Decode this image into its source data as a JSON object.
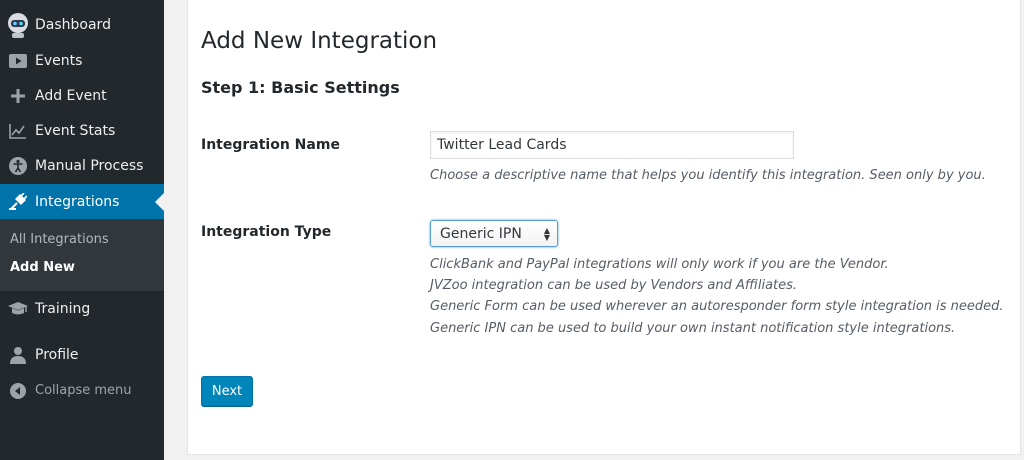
{
  "sidebar": {
    "items": [
      {
        "label": "Dashboard",
        "icon": "robot-avatar-icon"
      },
      {
        "label": "Events",
        "icon": "play-icon"
      },
      {
        "label": "Add Event",
        "icon": "plus-icon"
      },
      {
        "label": "Event Stats",
        "icon": "chart-icon"
      },
      {
        "label": "Manual Process",
        "icon": "accessibility-icon"
      },
      {
        "label": "Integrations",
        "icon": "plug-icon"
      },
      {
        "label": "Training",
        "icon": "graduation-cap-icon"
      },
      {
        "label": "Profile",
        "icon": "user-icon"
      },
      {
        "label": "Collapse menu",
        "icon": "collapse-arrow-icon"
      }
    ],
    "submenu": [
      {
        "label": "All Integrations"
      },
      {
        "label": "Add New"
      }
    ],
    "active_color": "#0073aa",
    "bg_color": "#23282d"
  },
  "main": {
    "title": "Add New Integration",
    "step_title": "Step 1: Basic Settings",
    "name_field": {
      "label": "Integration Name",
      "value": "Twitter Lead Cards",
      "description": "Choose a descriptive name that helps you identify this integration. Seen only by you."
    },
    "type_field": {
      "label": "Integration Type",
      "selected": "Generic IPN",
      "descriptions": [
        "ClickBank and PayPal integrations will only work if you are the Vendor.",
        "JVZoo integration can be used by Vendors and Affiliates.",
        "Generic Form can be used wherever an autoresponder form style integration is needed.",
        "Generic IPN can be used to build your own instant notification style integrations."
      ]
    },
    "next_label": "Next",
    "button_color": "#0085ba"
  }
}
